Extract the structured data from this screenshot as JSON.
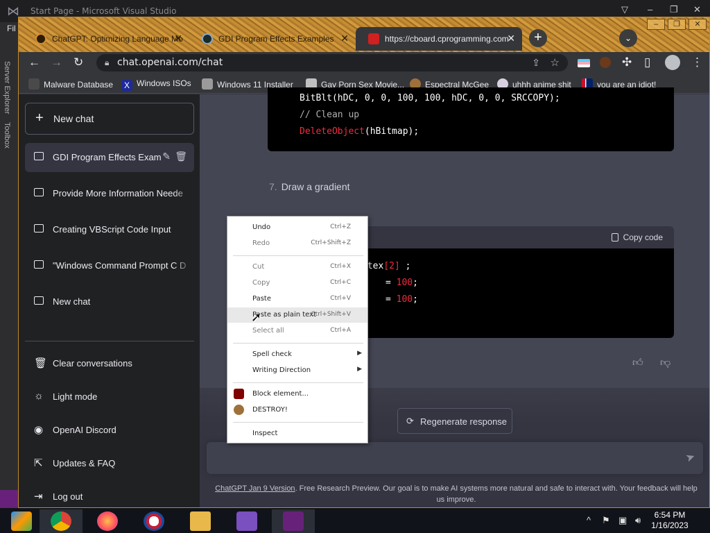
{
  "vs": {
    "title": "Start Page - Microsoft Visual Studio",
    "menu_file": "Fil",
    "server_explorer": "Server Explorer",
    "toolbox": "Toolbox"
  },
  "browser": {
    "tabs": [
      {
        "label": "ChatGPT: Optimizing Language Mo",
        "icon": "openai-icon"
      },
      {
        "label": "GDI Program Effects Examples",
        "icon": "openai-icon"
      },
      {
        "label": "https://cboard.cprogramming.com",
        "icon": "cboard-icon"
      }
    ],
    "url": "chat.openai.com/chat",
    "bookmarks": [
      "Malware Database",
      "Windows ISOs",
      "Windows 11 Installer",
      "Gay Porn Sex Movie...",
      "Espectral McGee",
      "uhhh anime shit",
      "you are an idiot!"
    ]
  },
  "sidebar": {
    "new_chat": "New chat",
    "conversations": [
      "GDI Program Effects Exam",
      "Provide More Information Neede",
      "Creating VBScript Code Input",
      "\"Windows Command Prompt C D",
      "New chat"
    ],
    "bottom_items": [
      {
        "label": "Clear conversations",
        "icon": "trash-icon"
      },
      {
        "label": "Light mode",
        "icon": "sun-icon"
      },
      {
        "label": "OpenAI Discord",
        "icon": "discord-icon"
      },
      {
        "label": "Updates & FAQ",
        "icon": "external-link-icon"
      },
      {
        "label": "Log out",
        "icon": "logout-icon"
      }
    ]
  },
  "main": {
    "code1_line1": "BitBlt(hDC, 0, 0, 100, 100, hDC, 0, 0, SRCCOPY);",
    "code1_line2": "// Clean up",
    "code1_line3": "DeleteObject",
    "code1_line3_rest": "(hBitmap);",
    "step_number": "7.",
    "step_text": "Draw a gradient",
    "copy_code": "Copy code",
    "code2_line1a": "rtex",
    "code2_line1b": "[2]",
    "code2_line1c": " ;",
    "code2_line2a": "= ",
    "code2_line2b": "100",
    "code2_line2c": ";",
    "code2_line3a": "= ",
    "code2_line3b": "100",
    "code2_line3c": ";",
    "regenerate": "Regenerate response",
    "footer_link": "ChatGPT Jan 9 Version",
    "footer_text": ". Free Research Preview. Our goal is to make AI systems more natural and safe to interact with. Your feedback will help us improve."
  },
  "context_menu": {
    "items": [
      {
        "label": "Undo",
        "shortcut": "Ctrl+Z",
        "disabled": false
      },
      {
        "label": "Redo",
        "shortcut": "Ctrl+Shift+Z",
        "disabled": true
      },
      {
        "label": "Cut",
        "shortcut": "Ctrl+X",
        "disabled": true
      },
      {
        "label": "Copy",
        "shortcut": "Ctrl+C",
        "disabled": true
      },
      {
        "label": "Paste",
        "shortcut": "Ctrl+V",
        "disabled": false
      },
      {
        "label": "Paste as plain text",
        "shortcut": "Ctrl+Shift+V",
        "disabled": false
      },
      {
        "label": "Select all",
        "shortcut": "Ctrl+A",
        "disabled": true
      },
      {
        "label": "Spell check",
        "shortcut": "",
        "disabled": false
      },
      {
        "label": "Writing Direction",
        "shortcut": "",
        "disabled": false
      },
      {
        "label": "Block element...",
        "shortcut": "",
        "disabled": false
      },
      {
        "label": "DESTROY!",
        "shortcut": "",
        "disabled": false
      },
      {
        "label": "Inspect",
        "shortcut": "",
        "disabled": false
      }
    ]
  },
  "taskbar": {
    "time": "6:54 PM",
    "date": "1/16/2023"
  },
  "colors": {
    "sidebar_bg": "#202123",
    "main_bg": "#444654",
    "code_keyword": "#f22c3d",
    "accent_purple": "#68217a"
  }
}
